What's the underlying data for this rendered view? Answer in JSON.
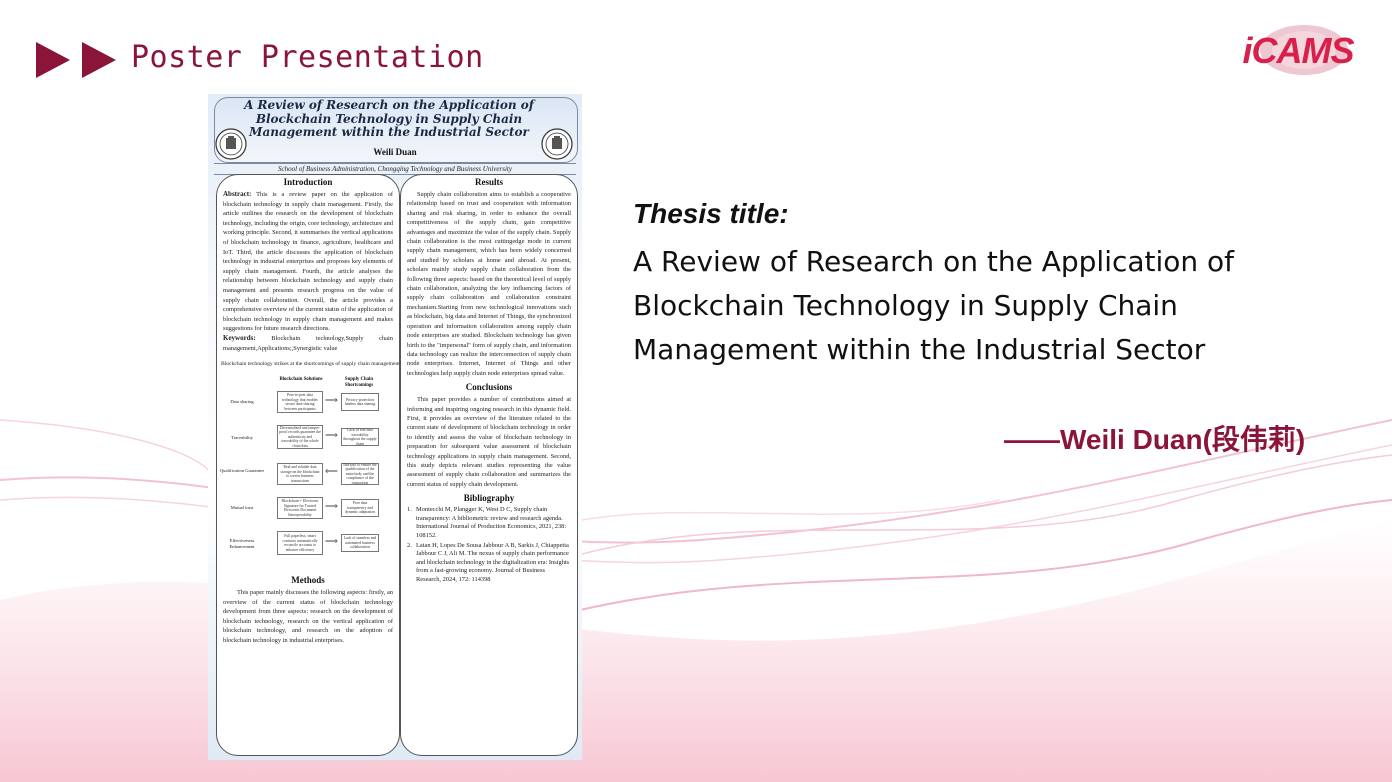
{
  "header": {
    "title": "Poster Presentation",
    "logo_text": "iCAMS",
    "accent_color": "#8b1538"
  },
  "poster": {
    "title": "A Review of Research on the Application of Blockchain Technology in Supply Chain Management within the Industrial Sector",
    "author": "Weili Duan",
    "affiliation": "School of Business Administration, Chongqing Technology and Business University",
    "introduction": {
      "heading": "Introduction",
      "abstract_label": "Abstract:",
      "abstract_text": " This is a review paper on the application of blockchain technology in supply chain management. Firstly, the article outlines the research on the development of blockchain technology, including the origin, core technology, architecture and working principle. Second, it summarises the vertical applications of blockchain technology in finance, agriculture, healthcare and IoT. Third, the article discusses the application of blockchain technology in industrial enterprises and proposes key elements of supply chain management. Fourth, the article analyses the relationship between blockchain technology and supply chain management and presents research progress on the value of supply chain collaboration. Overall, the article provides a comprehensive overview of the current status of the application of blockchain technology in supply chain management and makes suggestions for future research directions.",
      "keywords_label": "Keywords:",
      "keywords_text": " Blockchain technology,Supply chain management,Applications;,Synergistic value"
    },
    "figure": {
      "caption": "Blockchain technology strikes at the shortcomings of supply chain management",
      "col_left_header": "Blockchain Solutions",
      "col_right_header": "Supply Chain Shortcomings",
      "rows": [
        {
          "label": "Data sharing",
          "solution": "Peer-to-peer data technology that enables secure data sharing between participants",
          "shortcoming": "Privacy protection hinders data sharing"
        },
        {
          "label": "Traceability",
          "solution": "Decentralized and tamper-proof records guarantee the authenticity and traceability of the whole chain data",
          "shortcoming": "Lack of real data traceability throughout the supply chain"
        },
        {
          "label": "Qualification Guarantee",
          "solution": "Real and reliable data storage on the blockchain to screen business transactions",
          "shortcoming": "Difficult to ensure the qualification of the main body and the compliance of the transaction"
        },
        {
          "label": "Mutual trust",
          "solution": "Blockchain + Electronic Signature for Trusted Electronic Document Interoperability",
          "shortcoming": "Poor data transparency and dynamic adaptation"
        },
        {
          "label": "Effectiveness Enhancement",
          "solution": "Full paperless, smart contracts automatically reconcile accounts to enhance efficiency",
          "shortcoming": "Lack of seamless and automated business collaboration"
        }
      ]
    },
    "methods": {
      "heading": "Methods",
      "text": "This paper mainly discusses the following aspects: firstly, an overview of the current status of blockchain technology development from three aspects: research on the development of blockchain technology, research on the vertical application of blockchain technology, and research on the adoption of blockchain technology in industrial enterprises."
    },
    "results": {
      "heading": "Results",
      "text": "Supply chain collaboration aims to establish a cooperative relationship based on trust and cooperation with information sharing and risk sharing, in order to enhance the overall competitiveness of the supply chain, gain competitive advantages and maximize the value of the supply chain. Supply chain collaboration is the most cuttingedge mode in current supply chain management, which has been widely concerned and studied by scholars at home and abroad. At present, scholars mainly study supply chain collaboration from the following three aspects: based on the theoretical level of supply chain collaboration, analyzing the key influencing factors of supply chain collaboration and collaboration constraint mechanism.Starting from new technological innovations such as blockchain, big data and Internet of Things, the synchronized operation and information collaboration among supply chain node enterprises are studied. Blockchain technology has given birth to the \"impersonal\" form of supply chain, and information data technology can realize the interconnection of supply chain node enterprises. Internet, Internet of Things and other technologies help supply chain node enterprises spread value."
    },
    "conclusions": {
      "heading": "Conclusions",
      "text": "This paper provides a number of contributions aimed at informing and inspiring ongoing research in this dynamic field. First, it provides an overview of the literature related to the current state of development of blockchain technology in order to identify and assess the value of blockchain technology in preparation for subsequent value assessment of blockchain technology applications in supply chain management. Second, this study depicts relevant studies representing the value assessment of supply chain collaboration and summarizes the current status of supply chain development."
    },
    "bibliography": {
      "heading": "Bibliography",
      "items": [
        {
          "num": "1.",
          "text": "Montecchi M, Plangger K, West D C, Supply chain transparency: A bibliometric review and research agenda. International Journal of Production Economics, 2021, 238: 108152."
        },
        {
          "num": "2.",
          "text": "Latan H, Lopes De Sousa Jabbour A B, Sarkis J, Chiappetta Jabbour C J, Ali M. The nexus of supply chain performance and blockchain technology in the digitalization era: Insights from a fast-growing economy. Journal of Business Research, 2024, 172: 114398"
        }
      ]
    }
  },
  "thesis": {
    "label": "Thesis title:",
    "title": "A Review of Research on the Application of Blockchain Technology in Supply Chain Management within the Industrial Sector",
    "author": "——Weili Duan(段伟莉)"
  }
}
